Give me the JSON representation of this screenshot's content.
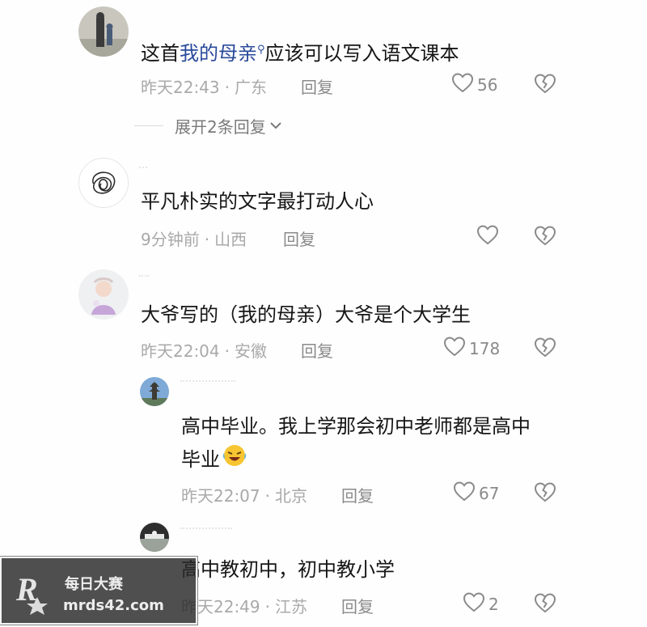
{
  "comments": [
    {
      "text_before": "这首",
      "link": "我的母亲",
      "text_after": "应该可以写入语文课本",
      "time": "昨天22:43",
      "location": "广东",
      "reply_label": "回复",
      "likes": "56",
      "expand_label": "展开2条回复"
    },
    {
      "text": "平凡朴实的文字最打动人心",
      "time": "9分钟前",
      "location": "山西",
      "reply_label": "回复",
      "likes": ""
    },
    {
      "text": "大爷写的（我的母亲）大爷是个大学生",
      "time": "昨天22:04",
      "location": "安徽",
      "reply_label": "回复",
      "likes": "178"
    }
  ],
  "replies": [
    {
      "text_line1": "高中毕业。我上学那会初中老师都是高中",
      "text_line2": "毕业",
      "emoji": "laughing-crying-emoji",
      "time": "昨天22:07",
      "location": "北京",
      "reply_label": "回复",
      "likes": "67"
    },
    {
      "text": "高中教初中，初中教小学",
      "time": "昨天22:49",
      "location": "江苏",
      "reply_label": "回复",
      "likes": "2"
    }
  ],
  "meta_separator": "·",
  "watermark": {
    "line1": "每日大赛",
    "line2": "mrds42.com"
  },
  "colors": {
    "link": "#2a4a9b",
    "meta": "#a9a9a9",
    "icon": "#8a8a8a"
  }
}
